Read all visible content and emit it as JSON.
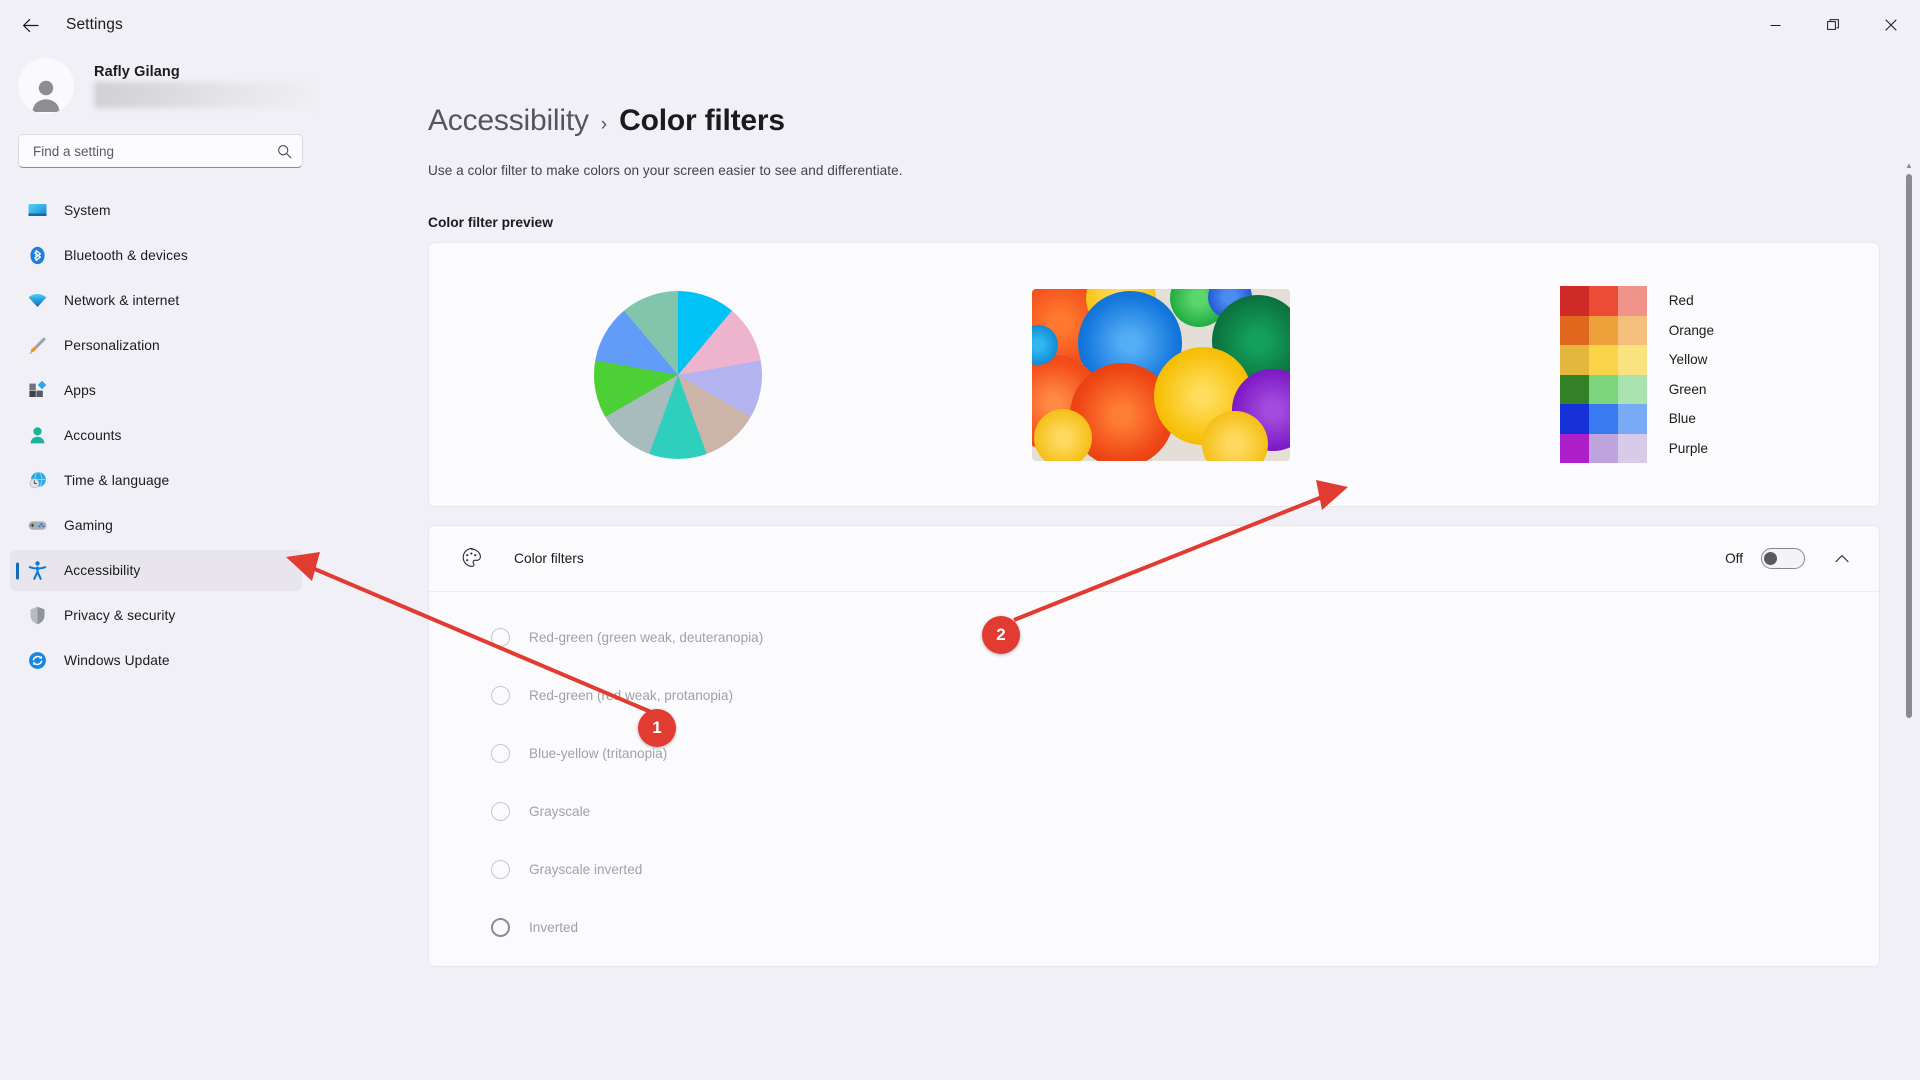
{
  "window": {
    "title": "Settings",
    "back_icon": "back-arrow-icon",
    "minimize_label": "Minimize",
    "maximize_label": "Restore",
    "close_label": "Close"
  },
  "profile": {
    "name": "Rafly Gilang",
    "email_redacted": true,
    "avatar_icon": "person-avatar-icon"
  },
  "search": {
    "placeholder": "Find a setting",
    "value": "",
    "icon": "search-icon"
  },
  "sidebar": {
    "items": [
      {
        "label": "System",
        "icon": "monitor-icon",
        "active": false
      },
      {
        "label": "Bluetooth & devices",
        "icon": "bluetooth-icon",
        "active": false
      },
      {
        "label": "Network & internet",
        "icon": "wifi-icon",
        "active": false
      },
      {
        "label": "Personalization",
        "icon": "paintbrush-icon",
        "active": false
      },
      {
        "label": "Apps",
        "icon": "apps-icon",
        "active": false
      },
      {
        "label": "Accounts",
        "icon": "person-icon",
        "active": false
      },
      {
        "label": "Time & language",
        "icon": "clock-globe-icon",
        "active": false
      },
      {
        "label": "Gaming",
        "icon": "gamepad-icon",
        "active": false
      },
      {
        "label": "Accessibility",
        "icon": "accessibility-icon",
        "active": true
      },
      {
        "label": "Privacy & security",
        "icon": "shield-icon",
        "active": false
      },
      {
        "label": "Windows Update",
        "icon": "update-refresh-icon",
        "active": false
      }
    ]
  },
  "main": {
    "breadcrumb_parent": "Accessibility",
    "breadcrumb_separator": "›",
    "breadcrumb_current": "Color filters",
    "description": "Use a color filter to make colors on your screen easier to see and differentiate.",
    "preview_section_title": "Color filter preview"
  },
  "preview": {
    "wheel": {
      "name": "color-wheel",
      "segments": [
        {
          "name": "cyan",
          "color": "#00c2f5"
        },
        {
          "name": "pink",
          "color": "#eeb3cd"
        },
        {
          "name": "lavender",
          "color": "#b3b3f0"
        },
        {
          "name": "tan",
          "color": "#cdb4a8"
        },
        {
          "name": "teal",
          "color": "#2ed0bd"
        },
        {
          "name": "gray-blue",
          "color": "#a9bcbd"
        },
        {
          "name": "green",
          "color": "#4cd035"
        },
        {
          "name": "blue",
          "color": "#619cf8"
        },
        {
          "name": "seagreen",
          "color": "#82c5ad"
        }
      ]
    },
    "photo": {
      "name": "colorful-paper-fans-photo",
      "alt": "Colorful paper fan rosettes"
    },
    "swatches": [
      {
        "label": "Red",
        "shades": [
          "#cf2a25",
          "#ec4b36",
          "#f0948a"
        ]
      },
      {
        "label": "Orange",
        "shades": [
          "#e1661e",
          "#eea03a",
          "#f4bf7c"
        ]
      },
      {
        "label": "Yellow",
        "shades": [
          "#e3b63c",
          "#f9d348",
          "#fae37f"
        ]
      },
      {
        "label": "Green",
        "shades": [
          "#328127",
          "#7cd57c",
          "#a9e3af"
        ]
      },
      {
        "label": "Blue",
        "shades": [
          "#1430d6",
          "#3a7af0",
          "#79aaf5"
        ]
      },
      {
        "label": "Purple",
        "shades": [
          "#ad20c9",
          "#bda4dc",
          "#d8cbe9"
        ]
      }
    ]
  },
  "color_filters": {
    "icon": "palette-icon",
    "title": "Color filters",
    "toggle_state": "Off",
    "toggle_on": false,
    "expanded": true,
    "collapse_icon": "chevron-up-icon",
    "options": [
      {
        "label": "Red-green (green weak, deuteranopia)",
        "selected": false,
        "hovered": false
      },
      {
        "label": "Red-green (red weak, protanopia)",
        "selected": false,
        "hovered": false
      },
      {
        "label": "Blue-yellow (tritanopia)",
        "selected": false,
        "hovered": false
      },
      {
        "label": "Grayscale",
        "selected": false,
        "hovered": false
      },
      {
        "label": "Grayscale inverted",
        "selected": false,
        "hovered": false
      },
      {
        "label": "Inverted",
        "selected": false,
        "hovered": true
      }
    ]
  },
  "annotations": {
    "color": "#e23b32",
    "markers": [
      {
        "number": "1",
        "target": "sidebar-item-accessibility"
      },
      {
        "number": "2",
        "target": "color-filters-toggle"
      }
    ]
  },
  "scrollbar": {
    "up_arrow": "▲",
    "down_arrow": "▼"
  }
}
